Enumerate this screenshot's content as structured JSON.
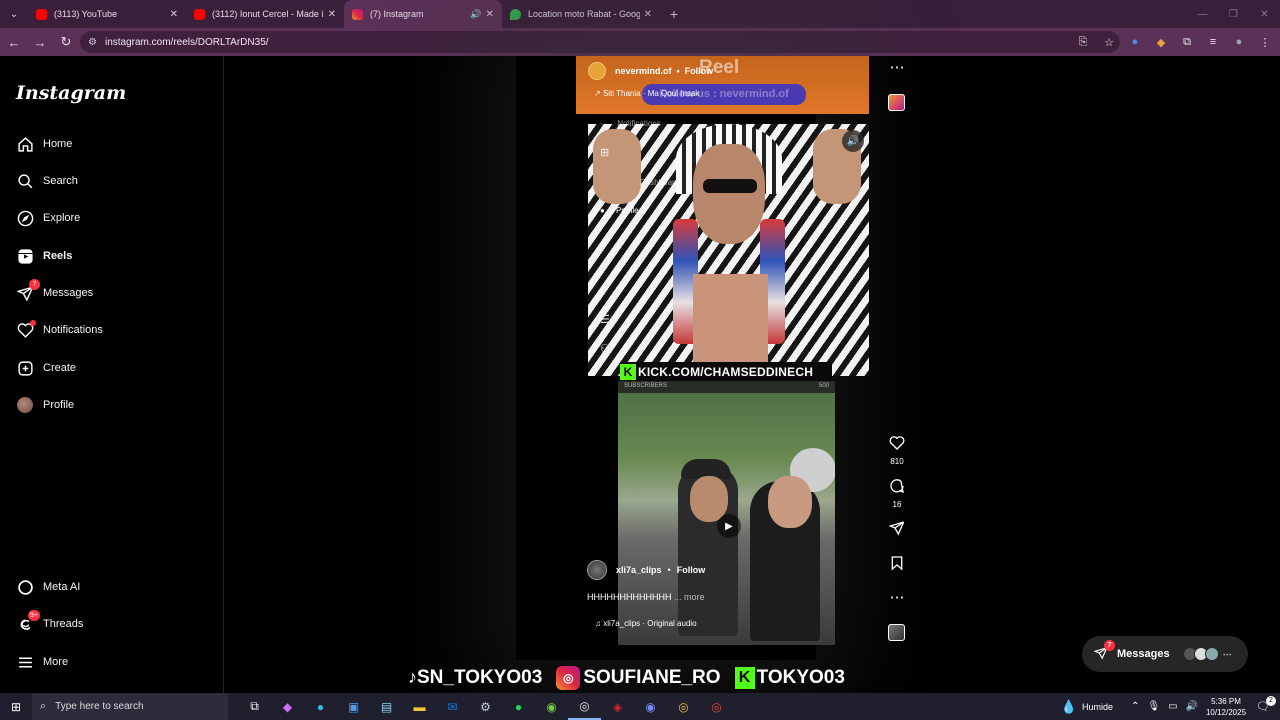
{
  "browser": {
    "tabs": [
      {
        "title": "(3113) YouTube",
        "favicon_color": "#ff0000",
        "active": false
      },
      {
        "title": "(3112) Ionut Cercel - Made in R",
        "favicon_color": "#ff0000",
        "active": false
      },
      {
        "title": "(7) Instagram",
        "favicon_color": "#e1306c",
        "active": true
      },
      {
        "title": "Location moto Rabat - Google",
        "favicon_color": "#34a853",
        "active": false
      }
    ],
    "url": "instagram.com/reels/DORLTArDN35/"
  },
  "sidebar": {
    "logo": "Instagram",
    "items": [
      {
        "label": "Home",
        "icon": "home-icon"
      },
      {
        "label": "Search",
        "icon": "search-icon"
      },
      {
        "label": "Explore",
        "icon": "compass-icon"
      },
      {
        "label": "Reels",
        "icon": "reels-icon",
        "active": true
      },
      {
        "label": "Messages",
        "icon": "messenger-icon",
        "badge": "7"
      },
      {
        "label": "Notifications",
        "icon": "heart-icon",
        "dot": true
      },
      {
        "label": "Create",
        "icon": "plus-square-icon"
      },
      {
        "label": "Profile",
        "icon": "avatar"
      }
    ],
    "bottom_items": [
      {
        "label": "Meta AI",
        "icon": "meta-ai-icon"
      },
      {
        "label": "Threads",
        "icon": "threads-icon",
        "badge": "9+"
      },
      {
        "label": "More",
        "icon": "hamburger-icon"
      }
    ]
  },
  "reel": {
    "overlay_account": "nevermind.of",
    "overlay_follow": "Follow",
    "overlay_reel_word": "Reel",
    "overlay_music": "Siti Thania · Ma Qoul Insak",
    "overlay_banner": "Follow us : nevermind.of",
    "ghost_menu": {
      "notifications": "Notifications",
      "dashboard": "Dashboard",
      "profile": "Profile"
    },
    "kick_text": "KICK.COM/CHAMSEDDINECH",
    "sub_bar_left": "SUBSCRIBERS",
    "sub_bar_right": "500",
    "username": "xli7a_clips",
    "follow": "Follow",
    "caption": "HHHHHHHHHHHHH",
    "caption_more": "... more",
    "audio": "xli7a_clips · Original audio",
    "likes": "810",
    "comments": "16",
    "social_tiktok": "SN_TOKYO03",
    "social_instagram": "SOUFIANE_RO",
    "social_kick": "TOKYO03"
  },
  "messages_pill": {
    "label": "Messages",
    "badge": "7"
  },
  "taskbar": {
    "search_placeholder": "Type here to search",
    "weather": "Humide",
    "time": "5:36 PM",
    "date": "10/12/2025",
    "notification_count": "2"
  }
}
